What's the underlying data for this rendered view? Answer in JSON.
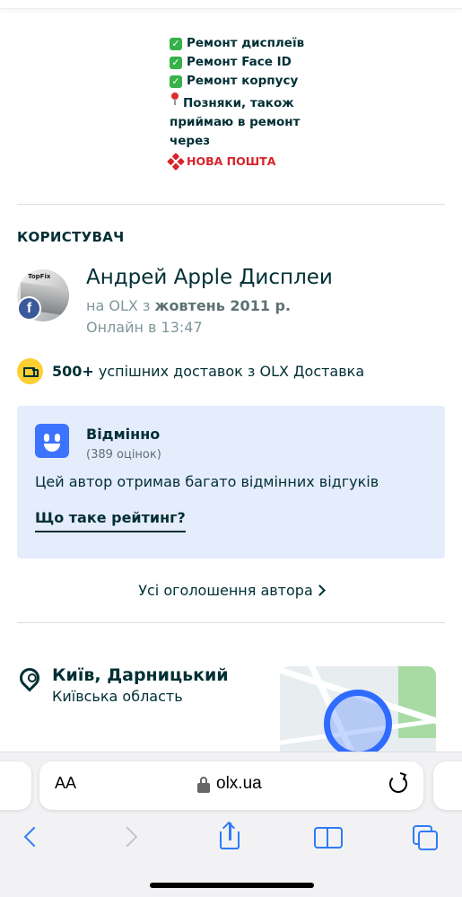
{
  "description": {
    "items": [
      {
        "icon": "check-icon",
        "text": "Ремонт дисплеїв"
      },
      {
        "icon": "check-icon",
        "text": "Ремонт Face ID"
      },
      {
        "icon": "check-icon",
        "text": "Ремонт корпусу"
      }
    ],
    "location_note": "Позняки, також приймаю в ремонт через",
    "carrier": "НОВА ПОШТА"
  },
  "user_section": {
    "title": "КОРИСТУВАЧ",
    "avatar_text": "TopFix",
    "name": "Андрей Apple Дисплеи",
    "since_prefix": "на OLX з",
    "since_date": "жовтень 2011 р.",
    "online": "Онлайн в 13:47"
  },
  "delivery": {
    "count": "500+",
    "text": "успішних доставок з OLX Доставка"
  },
  "rating": {
    "title": "Відмінно",
    "count": "(389 оцінок)",
    "text": "Цей автор отримав багато відмінних відгуків",
    "link": "Що таке рейтинг?"
  },
  "all_ads": "Усі оголошення автора",
  "location": {
    "city": "Київ, Дарницький",
    "region": "Київська область"
  },
  "browser": {
    "text_size": "AA",
    "domain": "olx.ua"
  },
  "colors": {
    "text_primary": "#002f34",
    "accent_blue": "#2f7cf6",
    "rating_card": "#e5ecfc",
    "delivery_yellow": "#ffce32"
  }
}
